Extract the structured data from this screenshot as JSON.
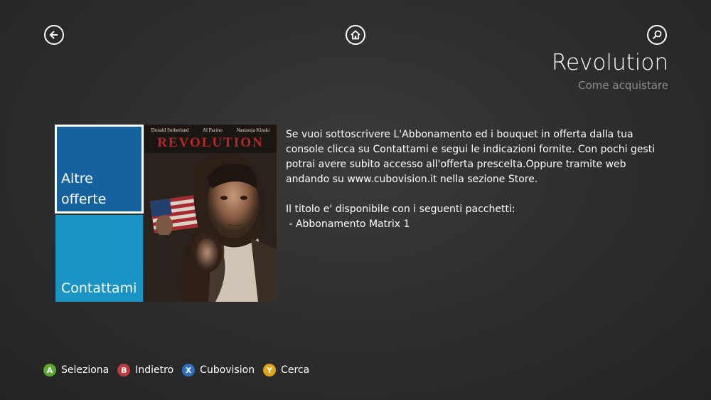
{
  "nav": {
    "back_icon": "back-arrow-icon",
    "home_icon": "home-icon",
    "search_icon": "search-icon"
  },
  "header": {
    "title": "Revolution",
    "subtitle": "Come acquistare"
  },
  "tiles": [
    {
      "label_line1": "Altre",
      "label_line2": "offerte",
      "color": "#15629f",
      "selected": true
    },
    {
      "label": "Contattami",
      "color": "#1a94c4",
      "selected": false
    }
  ],
  "poster": {
    "title": "REVOLUTION",
    "actors": [
      "Donald Sutherland",
      "Al Pacino",
      "Nastassja Kinski"
    ]
  },
  "description": {
    "paragraph1": "Se vuoi sottoscrivere L'Abbonamento ed i bouquet in offerta dalla tua console clicca su Contattami e segui le indicazioni fornite. Con pochi gesti potrai avere subito accesso all'offerta prescelta.Oppure tramite web andando su www.cubovision.it nella sezione Store.",
    "paragraph2": "Il titolo e' disponibile con i seguenti pacchetti:",
    "package": " - Abbonamento Matrix 1"
  },
  "footer": {
    "hints": [
      {
        "key": "A",
        "label": "Seleziona",
        "color": "#5aa832"
      },
      {
        "key": "B",
        "label": "Indietro",
        "color": "#c0383c"
      },
      {
        "key": "X",
        "label": "Cubovision",
        "color": "#2e6fb8"
      },
      {
        "key": "Y",
        "label": "Cerca",
        "color": "#e0a418"
      }
    ]
  }
}
